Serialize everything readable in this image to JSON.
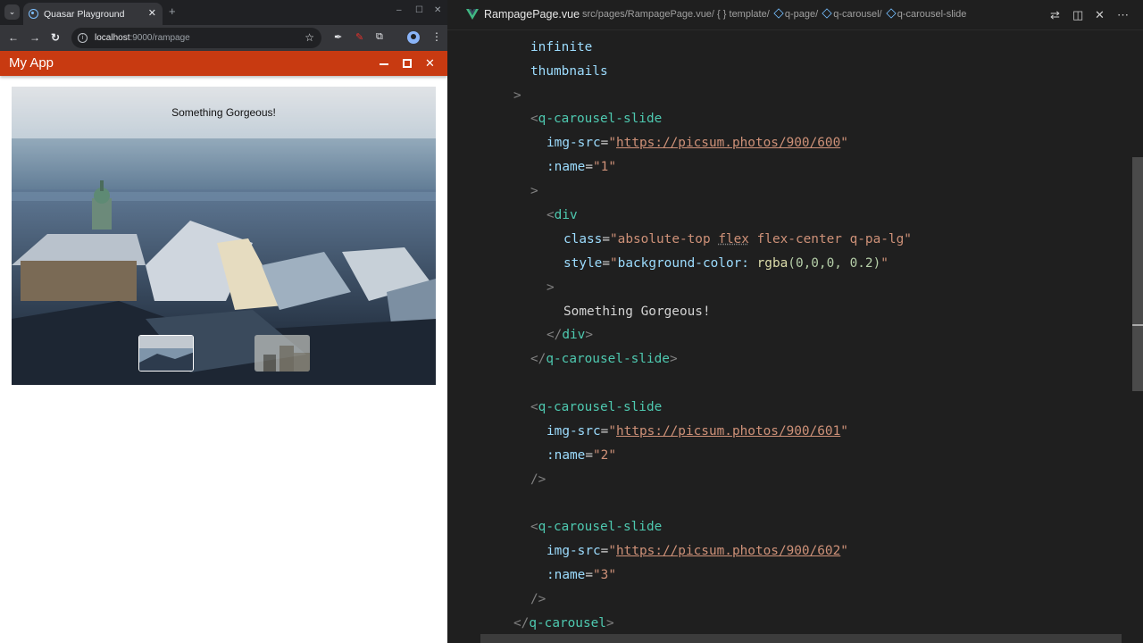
{
  "browser": {
    "tab_title": "Quasar Playground",
    "tab_close": "✕",
    "new_tab": "+",
    "url_host": "localhost",
    "url_rest": ":9000/rampage",
    "window_controls": [
      "–",
      "☐",
      "✕"
    ]
  },
  "app": {
    "title": "My App"
  },
  "carousel": {
    "caption": "Something Gorgeous!",
    "thumbnails": [
      "1",
      "2"
    ],
    "active_thumbnail": "1"
  },
  "editor": {
    "file_name": "RampagePage.vue",
    "breadcrumb_path": "src/pages/RampagePage.vue/",
    "breadcrumb_template": "{ } template/",
    "breadcrumb_items": [
      "q-page/",
      "q-carousel/",
      "q-carousel-slide"
    ],
    "code_lines": {
      "l1": "infinite",
      "l2": "thumbnails",
      "l3": ">",
      "l4_open": "<",
      "l4_tag": "q-carousel-slide",
      "l5_attr": "img-src",
      "l5_val": "https://picsum.photos/900/600",
      "l6_attr": ":name",
      "l6_val": "1",
      "l8_tag": "div",
      "l9_attr": "class",
      "l9_val_a": "absolute-top ",
      "l9_val_b": "flex",
      "l9_val_c": " flex-center q-pa-lg",
      "l10_attr": "style",
      "l10_val_a": "background-color: ",
      "l10_fn": "rgba",
      "l10_args": "(0,0,0, 0.2)",
      "l12_text": "Something Gorgeous!",
      "l13_close": "div",
      "l14_close": "q-carousel-slide",
      "l15_tag": "q-carousel-slide",
      "l16_val": "https://picsum.photos/900/601",
      "l17_val": "2",
      "l18_end": "/>",
      "l19_tag": "q-carousel-slide",
      "l20_val": "https://picsum.photos/900/602",
      "l21_val": "3",
      "l22_end": "/>",
      "l23_close": "q-carousel"
    }
  },
  "colors": {
    "app_header": "#c83a11",
    "editor_bg": "#1f1f1f",
    "tag": "#4ec9b0",
    "attr": "#9cdcfe",
    "string": "#ce9178"
  }
}
